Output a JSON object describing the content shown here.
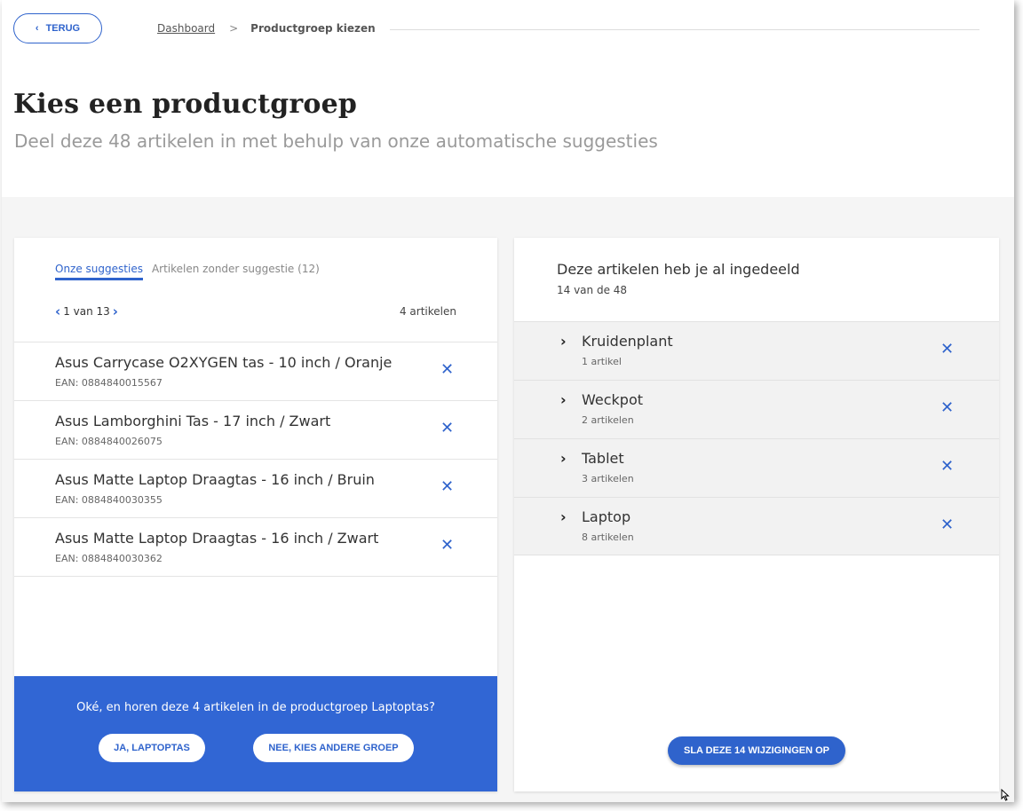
{
  "header": {
    "back_label": "TERUG",
    "breadcrumb": {
      "dashboard": "Dashboard",
      "separator": ">",
      "current": "Productgroep kiezen"
    },
    "title": "Kies een productgroep",
    "subtitle": "Deel deze 48 artikelen in met behulp van onze automatische suggesties"
  },
  "left_panel": {
    "tabs": [
      {
        "label": "Onze suggesties",
        "active": true
      },
      {
        "label": "Artikelen zonder suggestie (12)",
        "active": false
      }
    ],
    "pager": {
      "text": "1 van 13"
    },
    "count": "4 artikelen",
    "items": [
      {
        "name": "Asus Carrycase O2XYGEN tas - 10 inch / Oranje",
        "ean": "EAN: 0884840015567"
      },
      {
        "name": "Asus Lamborghini Tas - 17 inch / Zwart",
        "ean": "EAN: 0884840026075"
      },
      {
        "name": "Asus Matte Laptop Draagtas - 16 inch / Bruin",
        "ean": "EAN: 0884840030355"
      },
      {
        "name": "Asus Matte Laptop Draagtas - 16 inch / Zwart",
        "ean": "EAN: 0884840030362"
      }
    ],
    "confirm": {
      "question": "Oké, en horen deze 4 artikelen in de productgroep Laptoptas?",
      "yes_label": "JA, LAPTOPTAS",
      "no_label": "NEE, KIES ANDERE GROEP"
    }
  },
  "right_panel": {
    "title": "Deze artikelen heb je al ingedeeld",
    "subtitle": "14 van de 48",
    "groups": [
      {
        "name": "Kruidenplant",
        "count": "1 artikel"
      },
      {
        "name": "Weckpot",
        "count": "2 artikelen"
      },
      {
        "name": "Tablet",
        "count": "3 artikelen"
      },
      {
        "name": "Laptop",
        "count": "8 artikelen"
      }
    ],
    "save_label": "SLA DEZE 14 WIJZIGINGEN OP"
  },
  "colors": {
    "accent": "#2f63cc",
    "confirm_bar": "#3166d4",
    "content_bg": "#f5f5f5"
  },
  "icons": {
    "back": "chevron-left-icon",
    "remove": "close-icon",
    "expand": "chevron-right-icon"
  }
}
